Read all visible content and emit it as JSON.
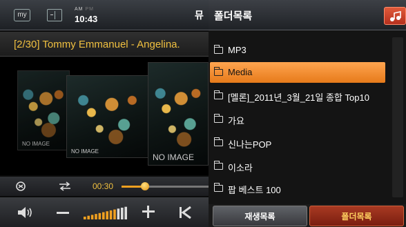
{
  "status_bar": {
    "my_label": "my",
    "am": "AM",
    "pm": "PM",
    "time": "10:43",
    "edge_tab": "뮤"
  },
  "now_playing": {
    "title": "[2/30] Tommy Emmanuel - Angelina."
  },
  "covers": [
    {
      "label": "NO IMAGE"
    },
    {
      "label": "NO IMAGE"
    },
    {
      "label": "NO IMAGE"
    }
  ],
  "seek": {
    "elapsed": "00:30",
    "progress_fraction": 0.27
  },
  "volume": {
    "level_fraction": 0.75
  },
  "folder_panel": {
    "title": "폴더목록",
    "items": [
      {
        "label": "MP3",
        "selected": false
      },
      {
        "label": "Media",
        "selected": true
      },
      {
        "label": "[멜론]_2011년_3월_21일 종합 Top10",
        "selected": false
      },
      {
        "label": "가요",
        "selected": false
      },
      {
        "label": "신나는POP",
        "selected": false
      },
      {
        "label": "이소라",
        "selected": false
      },
      {
        "label": "팝 베스트 100",
        "selected": false
      }
    ]
  },
  "tabs": {
    "playlist": "재생목록",
    "folders": "폴더목록"
  },
  "colors": {
    "accent_orange": "#f0a020",
    "time_yellow": "#f0c040",
    "selected_row": "#ff9a40",
    "active_tab_red": "#a83a22"
  }
}
